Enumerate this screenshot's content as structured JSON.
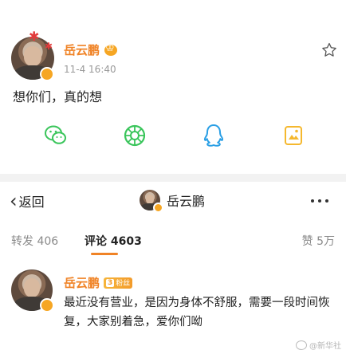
{
  "post": {
    "author": "岳云鹏",
    "timestamp": "11-4 16:40",
    "text": "想你们，真的想",
    "share_buttons": [
      "wechat-icon",
      "moments-icon",
      "qq-icon",
      "qzone-icon"
    ]
  },
  "nav": {
    "back_label": "返回",
    "title": "岳云鹏"
  },
  "tabs": {
    "repost": "转发 406",
    "comments": "评论 4603",
    "likes": "赞 5万"
  },
  "comment": {
    "author": "岳云鹏",
    "badge_level": "3",
    "badge_text": "粉丝",
    "text": "最近没有营业，是因为身体不舒服，需要一段时间恢复，大家别着急，爱你们呦"
  },
  "watermark": "@新华社",
  "colors": {
    "accent": "#f08326",
    "vip_gold": "#f6a623",
    "meta_gray": "#9a9a9a",
    "wechat_green": "#3ac55b",
    "qq_blue": "#2a9fe5",
    "qzone_yellow": "#f5b82e"
  }
}
